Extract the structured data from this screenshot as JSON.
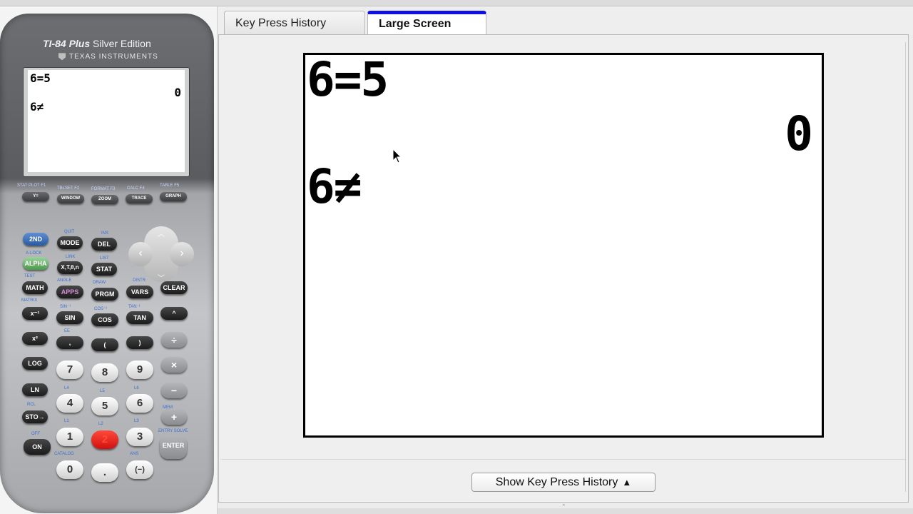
{
  "calculator": {
    "model_bold": "TI-84 Plus",
    "model_edition": "Silver Edition",
    "maker": "TEXAS INSTRUMENTS",
    "screen": {
      "line1": "6=5",
      "result": "0",
      "line2": "6≠"
    },
    "fn_labels": [
      "STAT PLOT F1",
      "TBLSET F2",
      "FORMAT F3",
      "CALC F4",
      "TABLE F5"
    ],
    "fn_keys": [
      "Y=",
      "WINDOW",
      "ZOOM",
      "TRACE",
      "GRAPH"
    ],
    "keys": {
      "second": "2ND",
      "mode": "MODE",
      "del": "DEL",
      "alpha": "ALPHA",
      "xt": "X,T,θ,n",
      "stat": "STAT",
      "math": "MATH",
      "apps": "APPS",
      "prgm": "PRGM",
      "vars": "VARS",
      "clear": "CLEAR",
      "inv": "x⁻¹",
      "sin": "SIN",
      "cos": "COS",
      "tan": "TAN",
      "pow": "^",
      "sq": "x²",
      "comma": ",",
      "lparen": "(",
      "rparen": ")",
      "div": "÷",
      "log": "LOG",
      "n7": "7",
      "n8": "8",
      "n9": "9",
      "mul": "×",
      "ln": "LN",
      "n4": "4",
      "n5": "5",
      "n6": "6",
      "minus": "−",
      "sto": "STO→",
      "n1": "1",
      "n2": "2",
      "n3": "3",
      "plus": "+",
      "on": "ON",
      "n0": "0",
      "dot": ".",
      "neg": "(−)",
      "enter": "ENTER"
    },
    "sublabels": {
      "quit": "QUIT",
      "ins": "INS",
      "alock": "A-LOCK",
      "link": "LINK",
      "list": "LIST",
      "test": "TEST",
      "angle": "ANGLE",
      "draw": "DRAW",
      "distr": "DISTR",
      "matrix": "MATRIX",
      "sin_inv": "SIN⁻¹",
      "cos_inv": "COS⁻¹",
      "tan_inv": "TAN⁻¹",
      "ee": "EE",
      "rcl": "RCL",
      "off": "OFF",
      "catalog": "CATALOG",
      "ans": "ANS",
      "entry": "ENTRY SOLVE",
      "mem": "MEM",
      "l1": "L1",
      "l2": "L2",
      "l3": "L3",
      "l4": "L4",
      "l5": "L5",
      "l6": "L6"
    }
  },
  "tabs": [
    {
      "label": "Key Press History",
      "active": false
    },
    {
      "label": "Large Screen",
      "active": true
    }
  ],
  "large_screen": {
    "line1": "6=5",
    "result": "0",
    "line2": "6≠"
  },
  "footer": {
    "show_button": "Show Key Press History",
    "arrow": "▲"
  },
  "colors": {
    "active_tab_accent": "#1010e0",
    "key_2nd": "#2a5ba0",
    "key_alpha": "#4c9a4c",
    "key_2_highlight": "#d01010"
  }
}
